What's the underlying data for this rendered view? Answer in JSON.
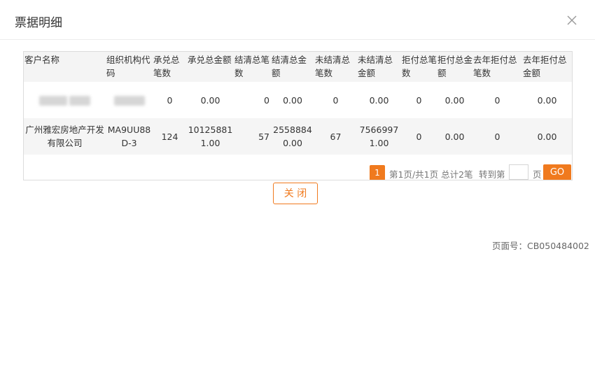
{
  "dialog": {
    "title": "票据明细",
    "close_icon": "close-icon"
  },
  "table": {
    "headers": [
      "客户名称",
      "组织机构代码",
      "承兑总笔数",
      "承兑总金额",
      "结清总笔数",
      "结清总金额",
      "未结清总笔数",
      "未结清总金额",
      "拒付总笔数",
      "拒付总金额",
      "去年拒付总笔数",
      "去年拒付总金额"
    ],
    "rows": [
      {
        "customer_name": "",
        "org_code": "",
        "accept_count": "0",
        "accept_amount": "0.00",
        "settled_count": "0",
        "settled_amount": "0.00",
        "unsettled_count": "0",
        "unsettled_amount": "0.00",
        "refused_count": "0",
        "refused_amount": "0.00",
        "last_year_refused_count": "0",
        "last_year_refused_amount": "0.00"
      },
      {
        "customer_name": "广州雅宏房地产开发有限公司",
        "org_code": "MA9UU88D-3",
        "accept_count": "124",
        "accept_amount": "101258811.00",
        "settled_count": "57",
        "settled_amount": "25588840.00",
        "unsettled_count": "67",
        "unsettled_amount": "75669971.00",
        "refused_count": "0",
        "refused_amount": "0.00",
        "last_year_refused_count": "0",
        "last_year_refused_amount": "0.00"
      }
    ]
  },
  "pager": {
    "current_page": "1",
    "info": "第1页/共1页 总计2笔",
    "goto_label": "转到第",
    "page_label": "页",
    "go_label": "GO",
    "goto_value": ""
  },
  "footer": {
    "close_label": "关 闭",
    "page_number": "页面号：CB050484002"
  },
  "colors": {
    "accent": "#f07a1e",
    "header_bg": "#f4f4f4",
    "stripe_bg": "#f5f5f5"
  }
}
